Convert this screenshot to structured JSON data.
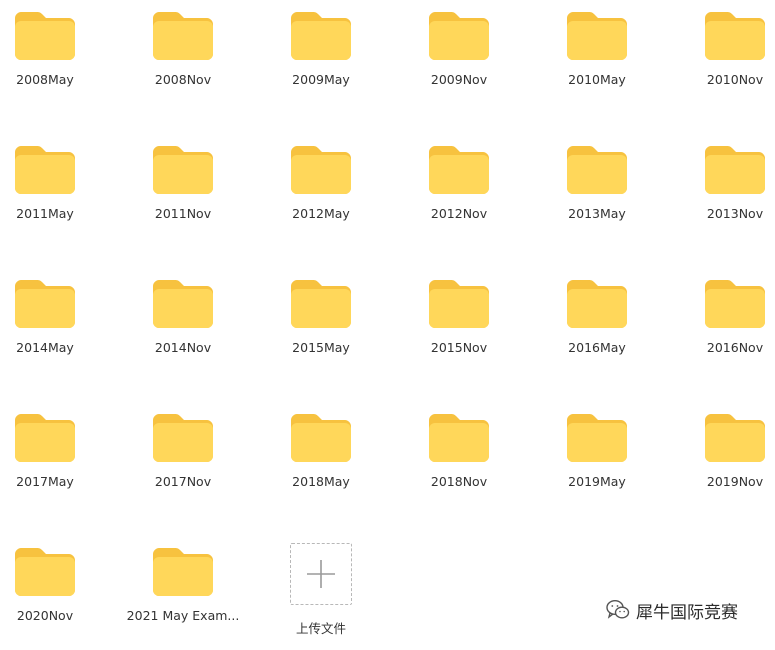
{
  "folders": [
    {
      "name": "2008May"
    },
    {
      "name": "2008Nov"
    },
    {
      "name": "2009May"
    },
    {
      "name": "2009Nov"
    },
    {
      "name": "2010May"
    },
    {
      "name": "2010Nov"
    },
    {
      "name": "2011May"
    },
    {
      "name": "2011Nov"
    },
    {
      "name": "2012May"
    },
    {
      "name": "2012Nov"
    },
    {
      "name": "2013May"
    },
    {
      "name": "2013Nov"
    },
    {
      "name": "2014May"
    },
    {
      "name": "2014Nov"
    },
    {
      "name": "2015May"
    },
    {
      "name": "2015Nov"
    },
    {
      "name": "2016May"
    },
    {
      "name": "2016Nov"
    },
    {
      "name": "2017May"
    },
    {
      "name": "2017Nov"
    },
    {
      "name": "2018May"
    },
    {
      "name": "2018Nov"
    },
    {
      "name": "2019May"
    },
    {
      "name": "2019Nov"
    },
    {
      "name": "2020Nov"
    },
    {
      "name": "2021 May Exam..."
    }
  ],
  "upload": {
    "label": "上传文件",
    "icon": "plus-icon"
  },
  "watermark": {
    "text": "犀牛国际竞赛",
    "icon": "wechat-icon"
  },
  "colors": {
    "folder_body": "#FFD75A",
    "folder_tab": "#F7C23F",
    "label_text": "#333333",
    "upload_border": "#B8B8B8"
  }
}
